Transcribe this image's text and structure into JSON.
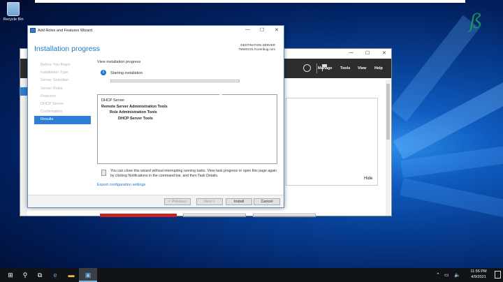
{
  "desktop": {
    "recycle_bin_label": "Recycle Bin"
  },
  "server_manager": {
    "menu": [
      "Manage",
      "Tools",
      "View",
      "Help"
    ],
    "hide_label": "Hide"
  },
  "wizard": {
    "window_title": "Add Roles and Features Wizard",
    "heading": "Installation progress",
    "destination_label": "DESTINATION SERVER",
    "destination_server": "TBWDC01.frozenbug.com",
    "steps": [
      {
        "label": "Before You Begin"
      },
      {
        "label": "Installation Type"
      },
      {
        "label": "Server Selection"
      },
      {
        "label": "Server Roles"
      },
      {
        "label": "Features"
      },
      {
        "label": "DHCP Server"
      },
      {
        "label": "Confirmation"
      },
      {
        "label": "Results"
      }
    ],
    "active_step": "Results",
    "view_progress_label": "View installation progress",
    "status_text": "Starting installation",
    "progress_fraction": 0.0,
    "results": [
      {
        "text": "DHCP Server",
        "indent": 0,
        "bold": false
      },
      {
        "text": "Remote Server Administration Tools",
        "indent": 0,
        "bold": true
      },
      {
        "text": "Role Administration Tools",
        "indent": 1,
        "bold": true
      },
      {
        "text": "DHCP Server Tools",
        "indent": 2,
        "bold": true
      }
    ],
    "note_text": "You can close this wizard without interrupting running tasks. View task progress or open this page again by clicking Notifications in the command bar, and then Task Details.",
    "export_link": "Export configuration settings",
    "buttons": {
      "previous": "< Previous",
      "next": "Next >",
      "install": "Install",
      "cancel": "Cancel"
    }
  },
  "taskbar": {
    "time": "11:56 PM",
    "date": "4/9/2021"
  }
}
